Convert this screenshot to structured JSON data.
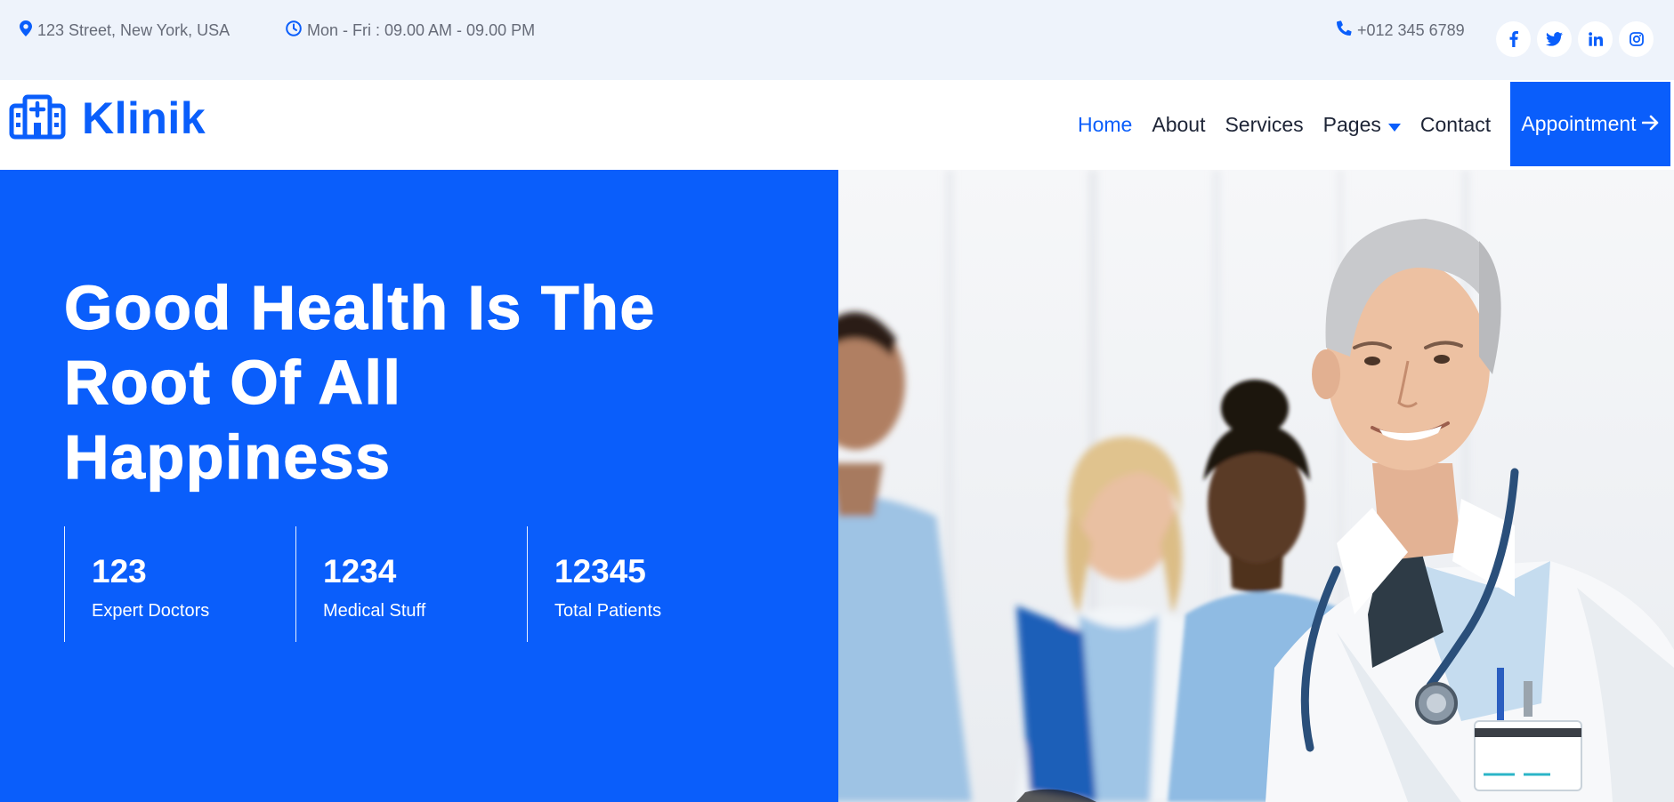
{
  "topbar": {
    "address": "123 Street, New York, USA",
    "hours": "Mon - Fri : 09.00 AM - 09.00 PM",
    "phone": "+012 345 6789",
    "socials": [
      "facebook-icon",
      "twitter-icon",
      "linkedin-icon",
      "instagram-icon"
    ]
  },
  "brand": {
    "name": "Klinik",
    "icon": "hospital-icon"
  },
  "nav": {
    "items": [
      "Home",
      "About",
      "Services",
      "Pages",
      "Contact"
    ],
    "active": "Home",
    "cta": "Appointment"
  },
  "hero": {
    "title_lines": [
      "Good Health Is The",
      "Root Of All",
      "Happiness"
    ],
    "stats": [
      {
        "value": "123",
        "label": "Expert Doctors"
      },
      {
        "value": "1234",
        "label": "Medical Stuff"
      },
      {
        "value": "12345",
        "label": "Total Patients"
      }
    ]
  },
  "colors": {
    "primary": "#0a5efb",
    "topbar_bg": "#eef3fb",
    "text_dark": "#1d2436"
  }
}
